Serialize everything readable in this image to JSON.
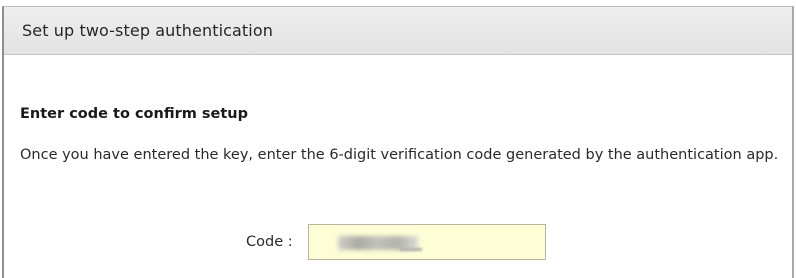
{
  "dialog": {
    "title": "Set up two-step authentication"
  },
  "section": {
    "title": "Enter code to confirm setup",
    "description": "Once you have entered the key, enter the 6-digit verification code generated by the authentication app."
  },
  "code_field": {
    "label": "Code :",
    "value": "",
    "value_note": "redacted",
    "background_color": "#fdfdd6"
  }
}
